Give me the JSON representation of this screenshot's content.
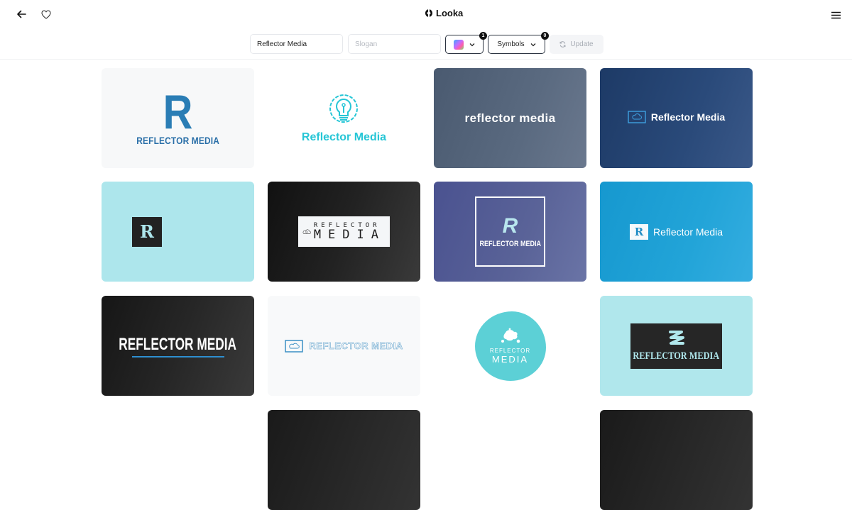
{
  "header": {
    "brand": "Looka",
    "icons": {
      "back": "arrow-left-icon",
      "favorite": "heart-icon",
      "menu": "hamburger-menu-icon",
      "logo": "looka-logo-icon"
    }
  },
  "controls": {
    "company_name_value": "Reflector Media",
    "slogan_value": "",
    "slogan_placeholder": "Slogan",
    "colors_badge": "1",
    "symbols_label": "Symbols",
    "symbols_badge": "0",
    "update_label": "Update"
  },
  "logos": [
    {
      "id": 1,
      "line1": "R",
      "line2": "REFLECTOR MEDIA",
      "text_color": "#2a7db5",
      "bg": "#f7f8f9"
    },
    {
      "id": 2,
      "icon": "lightbulb-gear-icon",
      "line1": "Reflector Media",
      "text_color": "#26c6d6",
      "bg": "#ffffff"
    },
    {
      "id": 3,
      "line1": "reflector media",
      "text_color": "#ffffff",
      "bg": "#4f5f75"
    },
    {
      "id": 4,
      "icon": "cloud-monitor-icon",
      "line1": "Reflector Media",
      "text_color": "#ffffff",
      "bg": "#233f6e"
    },
    {
      "id": 5,
      "line1": "R",
      "text_color": "#ade6ec",
      "bg": "#ade6ec"
    },
    {
      "id": 6,
      "icon": "cloud-lightbulb-icon",
      "line1": "REFLECTOR",
      "line2": "MEDIA",
      "text_color": "#1a1a1a",
      "bg": "#1c1c1c"
    },
    {
      "id": 7,
      "line1": "R",
      "line2": "REFLECTOR MEDIA",
      "text_color": "#ffffff",
      "bg": "#545c96"
    },
    {
      "id": 8,
      "line1": "R",
      "line2": "Reflector Media",
      "text_color": "#ffffff",
      "bg": "#1f9fd4"
    },
    {
      "id": 9,
      "line1": "REFLECTOR MEDIA",
      "text_color": "#ffffff",
      "bg": "#222222"
    },
    {
      "id": 10,
      "icon": "cloud-chart-icon",
      "line1": "REFLECTOR MEDIA",
      "text_color": "#3b8fc4",
      "bg": "#f8f9fa"
    },
    {
      "id": 11,
      "icon": "paint-splash-icon",
      "line1": "REFLECTOR",
      "line2": "MEDIA",
      "text_color": "#ffffff",
      "bg": "#5cd0d6"
    },
    {
      "id": 12,
      "icon": "ribbon-swirl-icon",
      "line1": "REFLECTOR MEDIA",
      "text_color": "#b0e7ec",
      "bg": "#b0e7ec"
    },
    {
      "id": 13
    },
    {
      "id": 14
    }
  ]
}
